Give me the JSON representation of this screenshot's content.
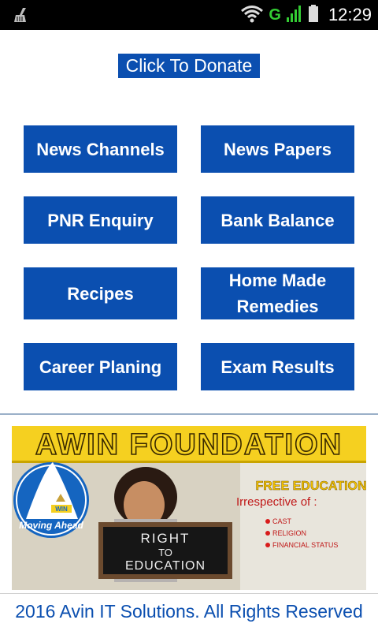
{
  "status_bar": {
    "network_letter": "G",
    "time": "12:29",
    "icons": [
      "cleaner-icon",
      "wifi-icon",
      "signal-icon",
      "battery-icon"
    ]
  },
  "donate": {
    "label": "Click To Donate"
  },
  "menu": {
    "items": [
      {
        "label": "News Channels"
      },
      {
        "label": "News Papers"
      },
      {
        "label": "PNR Enquiry"
      },
      {
        "label": "Bank Balance"
      },
      {
        "label": "Recipes"
      },
      {
        "label": "Home Made Remedies"
      },
      {
        "label": "Career Planing"
      },
      {
        "label": "Exam Results"
      }
    ]
  },
  "banner": {
    "title": "AWIN FOUNDATION",
    "logo_text": "WIN",
    "logo_tagline": "Moving Ahead",
    "slate_line1": "RIGHT",
    "slate_line2": "TO",
    "slate_line3": "EDUCATION",
    "free_heading": "FREE EDUCATION",
    "irrespective": "Irrespective of :",
    "bullets": [
      "CAST",
      "RELIGION",
      "FINANCIAL STATUS"
    ]
  },
  "footer": {
    "text": "2016 Avin IT Solutions. All Rights Reserved"
  },
  "colors": {
    "primary": "#0b4fb0",
    "status_bar": "#000000",
    "signal_green": "#33cc33",
    "banner_yellow": "#f5d020"
  }
}
